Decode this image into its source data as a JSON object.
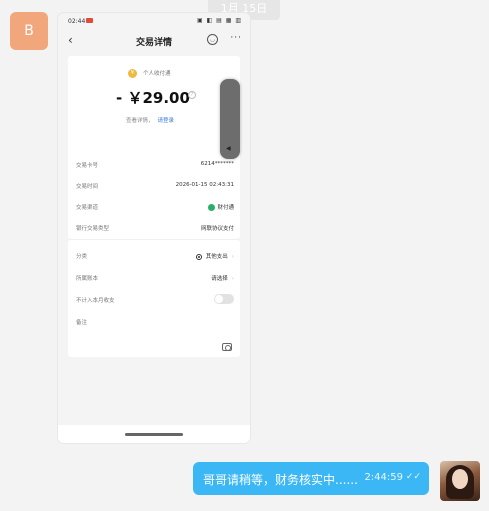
{
  "chat": {
    "date_pill": "1月 15日",
    "left_avatar_letter": "B",
    "outgoing_message": "哥哥请稍等，财务核实中......",
    "outgoing_time": "2:44:59",
    "read_ticks": "✓✓"
  },
  "phone": {
    "status_time": "02:44",
    "status_icons": "▣ ◧ ▤ ▦ ▥",
    "back_glyph": "‹",
    "title": "交易详情",
    "more_glyph": "···",
    "merchant": "个人收付通",
    "amount": "- ￥29.00",
    "hint_text": "查看详情，",
    "hint_link": "请登录",
    "rows": [
      {
        "label": "交易卡号",
        "value": "6214*******"
      },
      {
        "label": "交易时间",
        "value": "2026-01-15 02:43:31"
      },
      {
        "label": "交易渠道",
        "value": "财付通"
      },
      {
        "label": "银行交易类型",
        "value": "网联协议支付"
      }
    ],
    "category_label": "分类",
    "category_value": "其他支出",
    "account_label": "所属账本",
    "account_value": "请选择",
    "exclude_label": "不计入本月收支",
    "note_label": "备注"
  },
  "icons": {
    "camera": "camera-icon",
    "smile": "smile-icon",
    "coin": "coin-icon",
    "wechatpay": "wechatpay-icon"
  },
  "colors": {
    "bubble": "#3cb7f5",
    "link": "#3a7bd5",
    "coin": "#f0b940",
    "wechatpay": "#2aae67"
  }
}
